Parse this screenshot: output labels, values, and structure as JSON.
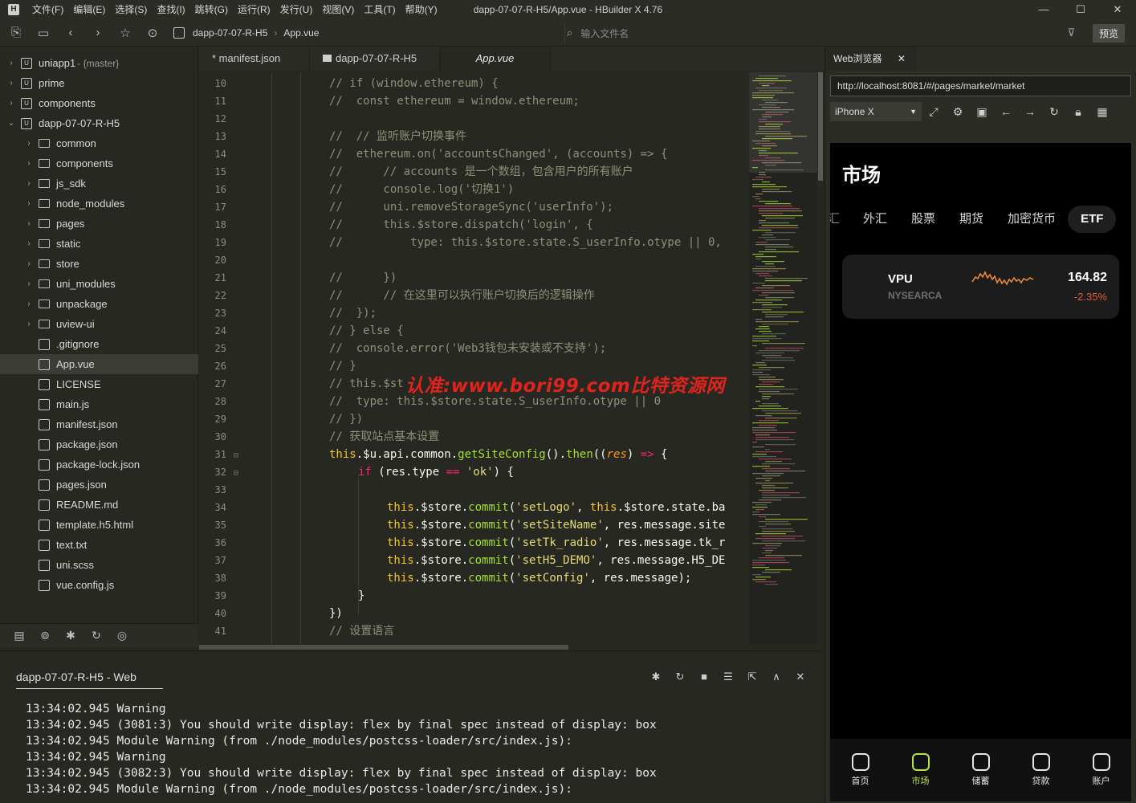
{
  "window": {
    "title": "dapp-07-07-R-H5/App.vue - HBuilder X 4.76",
    "menu": [
      "文件(F)",
      "编辑(E)",
      "选择(S)",
      "查找(I)",
      "跳转(G)",
      "运行(R)",
      "发行(U)",
      "视图(V)",
      "工具(T)",
      "帮助(Y)"
    ],
    "minimize": "—",
    "maximize": "☐",
    "close": "✕"
  },
  "toolbar": {
    "breadcrumb": [
      "dapp-07-07-R-H5",
      "App.vue"
    ],
    "file_search_placeholder": "输入文件名",
    "preview_label": "预览"
  },
  "sidebar": {
    "items": [
      {
        "label": "uniapp1",
        "extra": "- {master}",
        "type": "project"
      },
      {
        "label": "prime",
        "extra": "",
        "type": "project"
      },
      {
        "label": "components",
        "extra": "",
        "type": "project"
      },
      {
        "label": "dapp-07-07-R-H5",
        "extra": "",
        "type": "project-open"
      },
      {
        "label": "common",
        "type": "folder"
      },
      {
        "label": "components",
        "type": "folder"
      },
      {
        "label": "js_sdk",
        "type": "folder"
      },
      {
        "label": "node_modules",
        "type": "folder"
      },
      {
        "label": "pages",
        "type": "folder"
      },
      {
        "label": "static",
        "type": "folder"
      },
      {
        "label": "store",
        "type": "folder"
      },
      {
        "label": "uni_modules",
        "type": "folder"
      },
      {
        "label": "unpackage",
        "type": "folder"
      },
      {
        "label": "uview-ui",
        "type": "folder"
      },
      {
        "label": ".gitignore",
        "type": "file"
      },
      {
        "label": "App.vue",
        "type": "file",
        "active": true
      },
      {
        "label": "LICENSE",
        "type": "file"
      },
      {
        "label": "main.js",
        "type": "file"
      },
      {
        "label": "manifest.json",
        "type": "file"
      },
      {
        "label": "package.json",
        "type": "file"
      },
      {
        "label": "package-lock.json",
        "type": "file"
      },
      {
        "label": "pages.json",
        "type": "file"
      },
      {
        "label": "README.md",
        "type": "file"
      },
      {
        "label": "template.h5.html",
        "type": "file"
      },
      {
        "label": "text.txt",
        "type": "file"
      },
      {
        "label": "uni.scss",
        "type": "file"
      },
      {
        "label": "vue.config.js",
        "type": "file"
      }
    ]
  },
  "editor": {
    "tabs": [
      "* manifest.json",
      "dapp-07-07-R-H5",
      "App.vue"
    ],
    "watermark": "认准:www.bori99.com比特资源网",
    "lines": [
      {
        "n": "10",
        "indent": 0,
        "parts": [
          {
            "c": "cmt",
            "t": "// if (window.ethereum) {"
          }
        ]
      },
      {
        "n": "11",
        "indent": 0,
        "parts": [
          {
            "c": "cmt",
            "t": "//  const ethereum = window.ethereum;"
          }
        ]
      },
      {
        "n": "12",
        "indent": 0,
        "parts": []
      },
      {
        "n": "13",
        "indent": 0,
        "parts": [
          {
            "c": "cmt",
            "t": "//  // 监听账户切换事件"
          }
        ]
      },
      {
        "n": "14",
        "indent": 0,
        "parts": [
          {
            "c": "cmt",
            "t": "//  ethereum.on('accountsChanged', (accounts) => {"
          }
        ]
      },
      {
        "n": "15",
        "indent": 0,
        "parts": [
          {
            "c": "cmt",
            "t": "//      // accounts 是一个数组，包含用户的所有账户"
          }
        ]
      },
      {
        "n": "16",
        "indent": 0,
        "parts": [
          {
            "c": "cmt",
            "t": "//      console.log('切换1')"
          }
        ]
      },
      {
        "n": "17",
        "indent": 0,
        "parts": [
          {
            "c": "cmt",
            "t": "//      uni.removeStorageSync('userInfo');"
          }
        ]
      },
      {
        "n": "18",
        "indent": 0,
        "parts": [
          {
            "c": "cmt",
            "t": "//      this.$store.dispatch('login', {"
          }
        ]
      },
      {
        "n": "19",
        "indent": 0,
        "parts": [
          {
            "c": "cmt",
            "t": "//          type: this.$store.state.S_userInfo.otype || 0,"
          }
        ]
      },
      {
        "n": "20",
        "indent": 0,
        "parts": []
      },
      {
        "n": "21",
        "indent": 0,
        "parts": [
          {
            "c": "cmt",
            "t": "//      })"
          }
        ]
      },
      {
        "n": "22",
        "indent": 0,
        "parts": [
          {
            "c": "cmt",
            "t": "//      // 在这里可以执行账户切换后的逻辑操作"
          }
        ]
      },
      {
        "n": "23",
        "indent": 0,
        "parts": [
          {
            "c": "cmt",
            "t": "//  });"
          }
        ]
      },
      {
        "n": "24",
        "indent": 0,
        "parts": [
          {
            "c": "cmt",
            "t": "// } else {"
          }
        ]
      },
      {
        "n": "25",
        "indent": 0,
        "parts": [
          {
            "c": "cmt",
            "t": "//  console.error('Web3钱包未安装或不支持');"
          }
        ]
      },
      {
        "n": "26",
        "indent": 0,
        "parts": [
          {
            "c": "cmt",
            "t": "// }"
          }
        ]
      },
      {
        "n": "27",
        "indent": 0,
        "parts": [
          {
            "c": "cmt",
            "t": "// this.$st"
          }
        ]
      },
      {
        "n": "28",
        "indent": 0,
        "parts": [
          {
            "c": "cmt",
            "t": "//  type: this.$store.state.S_userInfo.otype || 0"
          }
        ]
      },
      {
        "n": "29",
        "indent": 0,
        "parts": [
          {
            "c": "cmt",
            "t": "// })"
          }
        ]
      },
      {
        "n": "30",
        "indent": 0,
        "parts": [
          {
            "c": "cmt",
            "t": "// 获取站点基本设置"
          }
        ]
      },
      {
        "n": "31",
        "indent": 0,
        "fold": "⊟",
        "parts": [
          {
            "c": "this",
            "t": "this"
          },
          {
            "c": "id",
            "t": ".$u.api.common."
          },
          {
            "c": "fn",
            "t": "getSiteConfig"
          },
          {
            "c": "id",
            "t": "()."
          },
          {
            "c": "fn",
            "t": "then"
          },
          {
            "c": "id",
            "t": "(("
          },
          {
            "c": "param",
            "t": "res"
          },
          {
            "c": "id",
            "t": ") "
          },
          {
            "c": "kw",
            "t": "=>"
          },
          {
            "c": "id",
            "t": " {"
          }
        ]
      },
      {
        "n": "32",
        "indent": 1,
        "fold": "⊟",
        "parts": [
          {
            "c": "kw",
            "t": "if"
          },
          {
            "c": "id",
            "t": " (res.type "
          },
          {
            "c": "kw",
            "t": "=="
          },
          {
            "c": "id",
            "t": " "
          },
          {
            "c": "str",
            "t": "'ok'"
          },
          {
            "c": "id",
            "t": ") {"
          }
        ]
      },
      {
        "n": "33",
        "indent": 0,
        "parts": []
      },
      {
        "n": "34",
        "indent": 2,
        "parts": [
          {
            "c": "this",
            "t": "this"
          },
          {
            "c": "id",
            "t": ".$store."
          },
          {
            "c": "fn",
            "t": "commit"
          },
          {
            "c": "id",
            "t": "("
          },
          {
            "c": "str",
            "t": "'setLogo'"
          },
          {
            "c": "id",
            "t": ", "
          },
          {
            "c": "this",
            "t": "this"
          },
          {
            "c": "id",
            "t": ".$store.state.ba"
          }
        ]
      },
      {
        "n": "35",
        "indent": 2,
        "parts": [
          {
            "c": "this",
            "t": "this"
          },
          {
            "c": "id",
            "t": ".$store."
          },
          {
            "c": "fn",
            "t": "commit"
          },
          {
            "c": "id",
            "t": "("
          },
          {
            "c": "str",
            "t": "'setSiteName'"
          },
          {
            "c": "id",
            "t": ", res.message.site"
          }
        ]
      },
      {
        "n": "36",
        "indent": 2,
        "parts": [
          {
            "c": "this",
            "t": "this"
          },
          {
            "c": "id",
            "t": ".$store."
          },
          {
            "c": "fn",
            "t": "commit"
          },
          {
            "c": "id",
            "t": "("
          },
          {
            "c": "str",
            "t": "'setTk_radio'"
          },
          {
            "c": "id",
            "t": ", res.message.tk_r"
          }
        ]
      },
      {
        "n": "37",
        "indent": 2,
        "parts": [
          {
            "c": "this",
            "t": "this"
          },
          {
            "c": "id",
            "t": ".$store."
          },
          {
            "c": "fn",
            "t": "commit"
          },
          {
            "c": "id",
            "t": "("
          },
          {
            "c": "str",
            "t": "'setH5_DEMO'"
          },
          {
            "c": "id",
            "t": ", res.message.H5_DE"
          }
        ]
      },
      {
        "n": "38",
        "indent": 2,
        "parts": [
          {
            "c": "this",
            "t": "this"
          },
          {
            "c": "id",
            "t": ".$store."
          },
          {
            "c": "fn",
            "t": "commit"
          },
          {
            "c": "id",
            "t": "("
          },
          {
            "c": "str",
            "t": "'setConfig'"
          },
          {
            "c": "id",
            "t": ", res.message);"
          }
        ]
      },
      {
        "n": "39",
        "indent": 1,
        "parts": [
          {
            "c": "id",
            "t": "}"
          }
        ]
      },
      {
        "n": "40",
        "indent": 0,
        "parts": [
          {
            "c": "id",
            "t": "})"
          }
        ]
      },
      {
        "n": "41",
        "indent": 0,
        "parts": [
          {
            "c": "cmt",
            "t": "// 设置语言"
          }
        ]
      }
    ]
  },
  "browser": {
    "tab_label": "Web浏览器",
    "tab_close": "✕",
    "url": "http://localhost:8081/#/pages/market/market",
    "device": "iPhone X"
  },
  "phone": {
    "title": "市场",
    "tabs": [
      "汇",
      "外汇",
      "股票",
      "期货",
      "加密货币",
      "ETF"
    ],
    "active_tab": "ETF",
    "asset": {
      "symbol": "VPU",
      "exchange": "NYSEARCA",
      "price": "164.82",
      "change": "-2.35%",
      "change_color": "#e35a3a"
    },
    "nav": [
      {
        "label": "首页",
        "icon": "home-icon"
      },
      {
        "label": "市场",
        "icon": "market-icon",
        "active": true
      },
      {
        "label": "储蓄",
        "icon": "savings-icon"
      },
      {
        "label": "贷款",
        "icon": "loan-icon"
      },
      {
        "label": "账户",
        "icon": "account-icon"
      }
    ],
    "accent": "#b8e34a"
  },
  "console": {
    "tab_label": "dapp-07-07-R-H5 - Web",
    "logs": [
      "13:34:02.945 Warning",
      "13:34:02.945 (3081:3) You should write display: flex by final spec instead of display: box",
      "13:34:02.945 Module Warning (from ./node_modules/postcss-loader/src/index.js):",
      "13:34:02.945 Warning",
      "13:34:02.945 (3082:3) You should write display: flex by final spec instead of display: box",
      "13:34:02.945 Module Warning (from ./node_modules/postcss-loader/src/index.js):"
    ]
  }
}
